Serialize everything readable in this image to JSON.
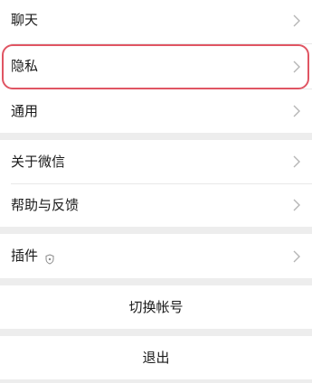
{
  "groups": [
    {
      "items": [
        {
          "label": "聊天"
        },
        {
          "label": "隐私"
        },
        {
          "label": "通用"
        }
      ]
    },
    {
      "items": [
        {
          "label": "关于微信"
        },
        {
          "label": "帮助与反馈"
        }
      ]
    },
    {
      "items": [
        {
          "label": "插件",
          "icon": "shield-icon"
        }
      ]
    }
  ],
  "actions": {
    "switch_account": "切换帐号",
    "logout": "退出"
  },
  "highlight": {
    "item": "隐私",
    "color": "#e05563"
  },
  "colors": {
    "background": "#ededed",
    "row": "#ffffff",
    "chevron": "#b5b5b5"
  },
  "icons": {
    "chevron": "chevron-right-icon",
    "plugin": "shield-icon"
  }
}
